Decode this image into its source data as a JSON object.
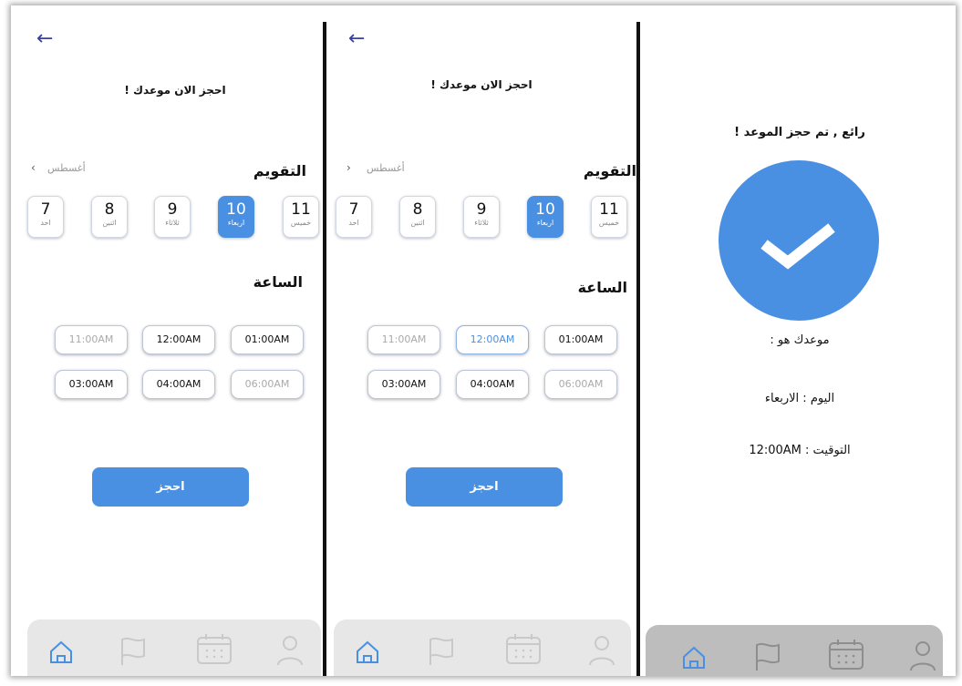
{
  "screen1": {
    "back_icon": "←",
    "title": "احجز الان موعدك !",
    "calendar_heading": "التقويم",
    "month_label": "أغسطس",
    "month_chevron": "‹",
    "days": [
      {
        "num": "11",
        "label": "خميس",
        "selected": false
      },
      {
        "num": "10",
        "label": "اربعاء",
        "selected": true
      },
      {
        "num": "9",
        "label": "ثلاثاء",
        "selected": false
      },
      {
        "num": "8",
        "label": "اثنين",
        "selected": false
      },
      {
        "num": "7",
        "label": "احد",
        "selected": false
      }
    ],
    "time_heading": "الساعة",
    "slots": [
      {
        "text": "11:00AM",
        "state": "disabled"
      },
      {
        "text": "12:00AM",
        "state": "normal"
      },
      {
        "text": "01:00AM",
        "state": "normal"
      },
      {
        "text": "03:00AM",
        "state": "normal"
      },
      {
        "text": "04:00AM",
        "state": "normal"
      },
      {
        "text": "06:00AM",
        "state": "disabled"
      }
    ],
    "book_label": "احجز"
  },
  "screen2": {
    "back_icon": "←",
    "title": "احجز الان موعدك !",
    "calendar_heading": "التقويم",
    "month_label": "أغسطس",
    "month_chevron": "›",
    "days": [
      {
        "num": "11",
        "label": "خميس",
        "selected": false
      },
      {
        "num": "10",
        "label": "اربعاء",
        "selected": true
      },
      {
        "num": "9",
        "label": "ثلاثاء",
        "selected": false
      },
      {
        "num": "8",
        "label": "اثنين",
        "selected": false
      },
      {
        "num": "7",
        "label": "احد",
        "selected": false
      }
    ],
    "time_heading": "الساعة",
    "slots": [
      {
        "text": "11:00AM",
        "state": "disabled"
      },
      {
        "text": "12:00AM",
        "state": "selected"
      },
      {
        "text": "01:00AM",
        "state": "normal"
      },
      {
        "text": "03:00AM",
        "state": "normal"
      },
      {
        "text": "04:00AM",
        "state": "normal"
      },
      {
        "text": "06:00AM",
        "state": "disabled"
      }
    ],
    "book_label": "احجز"
  },
  "screen3": {
    "title": "رائع , تم حجز الموعد !",
    "appointment_label": "موعدك هو :",
    "day_line": "اليوم : الاربعاء",
    "time_line": "التوقيت : 12:00AM"
  },
  "nav_icons": [
    "home-icon",
    "flag-icon",
    "calendar-icon",
    "user-icon"
  ],
  "colors": {
    "accent": "#4a90e2",
    "nav_bg": "#e7e7e7",
    "nav_bg_dark": "#bdbdbd"
  }
}
